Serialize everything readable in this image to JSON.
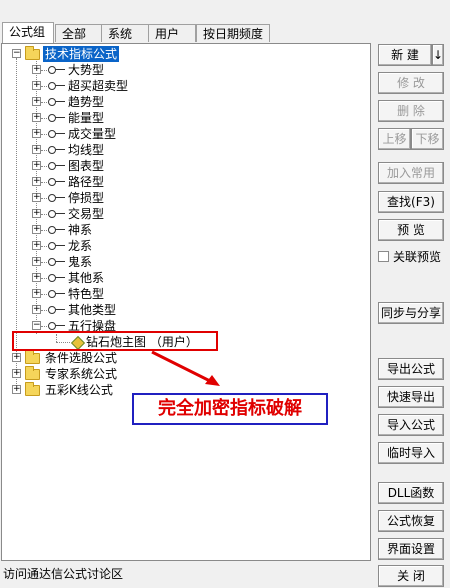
{
  "tabs": [
    "公式组",
    "全部",
    "系统",
    "用户",
    "按日期频度"
  ],
  "tree": {
    "root": "技术指标公式",
    "children": [
      "大势型",
      "超买超卖型",
      "趋势型",
      "能量型",
      "成交量型",
      "均线型",
      "图表型",
      "路径型",
      "停损型",
      "交易型",
      "神系",
      "龙系",
      "鬼系",
      "其他系",
      "特色型",
      "其他类型",
      "五行操盘"
    ],
    "leaf": "钻石炮主图 （用户）",
    "others": [
      "条件选股公式",
      "专家系统公式",
      "五彩K线公式"
    ]
  },
  "overlay": {
    "banner": "完全加密指标破解",
    "colors": {
      "box": "#e00000",
      "banner_border": "#2020c0",
      "banner_text": "#e00000"
    }
  },
  "buttons": {
    "new": "新 建",
    "new_arrow": "↓",
    "modify": "修 改",
    "delete": "删 除",
    "move_up": "上移",
    "move_down": "下移",
    "add_common": "加入常用",
    "find": "查找(F3)",
    "preview": "预 览",
    "link_preview": "关联预览",
    "sync_share": "同步与分享",
    "export": "导出公式",
    "quick_export": "快速导出",
    "import": "导入公式",
    "temp_import": "临时导入",
    "dll": "DLL函数",
    "restore": "公式恢复",
    "ui_settings": "界面设置",
    "close": "关 闭"
  },
  "status": "访问通达信公式讨论区"
}
